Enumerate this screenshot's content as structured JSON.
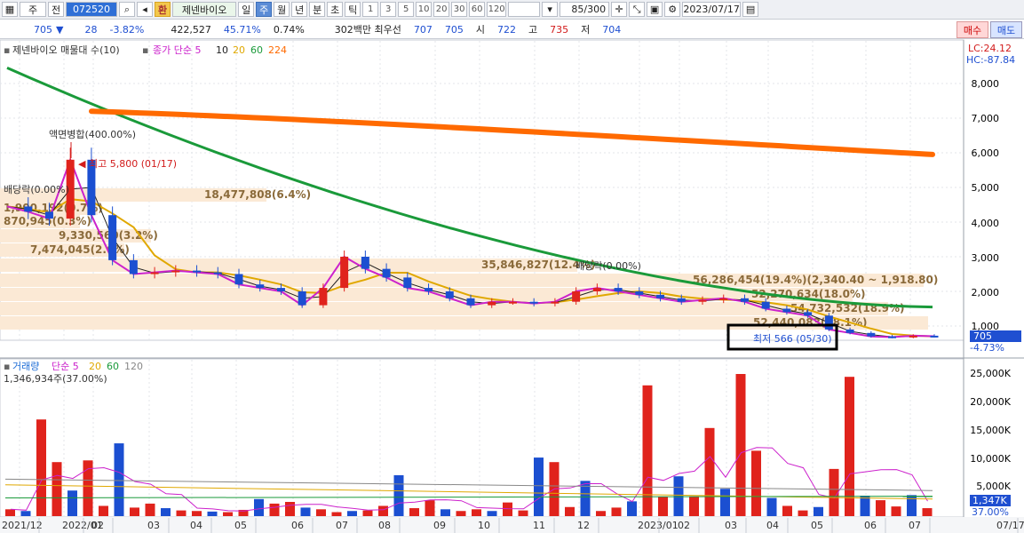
{
  "toolbar": {
    "period_menu": "주",
    "jeon": "전",
    "code": "072520",
    "hwan": "환",
    "stock_name": "제넨바이오",
    "periods": [
      "일",
      "주",
      "월",
      "년",
      "분",
      "초",
      "틱"
    ],
    "active_period": "주",
    "numbers": [
      "1",
      "3",
      "5",
      "10",
      "20",
      "30",
      "60",
      "120"
    ],
    "count": "85/300",
    "date": "2023/07/17"
  },
  "ticker": {
    "price": "705",
    "change": "28",
    "change_pct": "-3.82%",
    "volume": "422,527",
    "ratio1": "45.71%",
    "ratio2": "0.74%",
    "amount_label": "302백만 최우선",
    "best_ask": "707",
    "best_bid": "705",
    "open_label": "시",
    "open": "722",
    "high_label": "고",
    "high": "735",
    "low_label": "저",
    "low": "704",
    "buy": "매수",
    "sell": "매도"
  },
  "price_legend": {
    "title": "제넨바이오 매물대 수(10)",
    "ma_label": "종가 단순 5",
    "ma": [
      "10",
      "20",
      "60",
      "224"
    ]
  },
  "lc_hc": {
    "lc": "LC:24.12",
    "hc": "HC:-87.84"
  },
  "price_axis": [
    "8,000",
    "7,000",
    "6,000",
    "5,000",
    "4,000",
    "3,000",
    "2,000",
    "1,000"
  ],
  "current_price_tag": "705",
  "current_pct_tag": "-4.73%",
  "annotations": {
    "split": "액면병합(400.00%)",
    "high": "최고 5,800 (01/17)",
    "div1": "배당락(0.00%)",
    "div2": "배당락(0.00%)",
    "low": "최저 566 (05/30)"
  },
  "volume_profile_labels": [
    "18,477,808(6.4%)",
    "1,900,192(0.7%)",
    "870,945(0.3%)",
    "9,330,560(3.2%)",
    "7,474,045(2.6%)",
    "35,846,827(12.4%)",
    "56,286,454(19.4%)(2,340.40 ~ 1,918.80)",
    "52,270,634(18.0%)",
    "54,732,532(18.9%)",
    "52,440,083(18.1%)"
  ],
  "volume_legend": {
    "title": "거래량",
    "ma_label": "단순 5",
    "ma": [
      "20",
      "60",
      "120"
    ]
  },
  "volume_note": "1,346,934주(37.00%)",
  "volume_axis": [
    "25,000K",
    "20,000K",
    "15,000K",
    "10,000K",
    "5,000K"
  ],
  "volume_tag": "1,347K",
  "volume_pct_tag": "37.00%",
  "x_axis": [
    "2021/12",
    "2022/01",
    "02",
    "03",
    "04",
    "05",
    "06",
    "07",
    "08",
    "09",
    "10",
    "11",
    "12",
    "2023/01",
    "02",
    "03",
    "04",
    "05",
    "06",
    "07",
    "07/17"
  ],
  "colors": {
    "up": "#e0231c",
    "down": "#1b4fd1",
    "ma5": "#cc22cc",
    "ma10": "#222222",
    "ma20": "#e0a800",
    "ma60": "#1a9a3a",
    "ma224": "#ff6a00",
    "profile": "#fbe9d5"
  },
  "chart_data": {
    "type": "candlestick",
    "title": "제넨바이오 매물대 수(10)",
    "x": [
      "2021/12",
      "2022/01",
      "02",
      "03",
      "04",
      "05",
      "06",
      "07",
      "08",
      "09",
      "10",
      "11",
      "12",
      "2023/01",
      "02",
      "03",
      "04",
      "05",
      "06",
      "07"
    ],
    "ylim": [
      0,
      8600
    ],
    "close_series": [
      4450,
      4300,
      4100,
      5800,
      4200,
      2900,
      2500,
      2550,
      2600,
      2550,
      2500,
      2200,
      2100,
      2000,
      1600,
      2100,
      3000,
      2650,
      2400,
      2100,
      2000,
      1800,
      1600,
      1700,
      1700,
      1650,
      1700,
      2000,
      2100,
      2000,
      1900,
      1800,
      1700,
      1750,
      1800,
      1700,
      1500,
      1400,
      1300,
      900,
      800,
      700,
      680,
      720,
      705
    ],
    "ma224_range": [
      7200,
      5950
    ],
    "ma60_range": [
      8450,
      1550
    ],
    "volume_ylim": [
      0,
      26000
    ],
    "volume_unit": "K"
  }
}
